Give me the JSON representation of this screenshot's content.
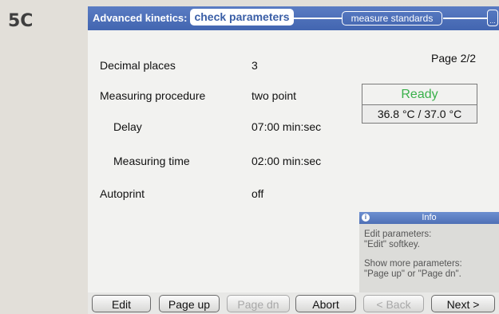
{
  "figure_label": "5C",
  "header": {
    "title": "Advanced kinetics:",
    "active_tab": "check parameters",
    "next_tab": "measure standards",
    "more_tab": "..."
  },
  "page_indicator": "Page 2/2",
  "parameters": [
    {
      "label": "Decimal places",
      "value": "3"
    },
    {
      "label": "Measuring procedure",
      "value": "two point"
    },
    {
      "label": "Delay",
      "value": "07:00 min:sec"
    },
    {
      "label": "Measuring time",
      "value": "02:00 min:sec"
    },
    {
      "label": "Autoprint",
      "value": "off"
    }
  ],
  "status": {
    "state": "Ready",
    "temperature": "36.8 °C / 37.0 °C",
    "state_color": "#39b04a"
  },
  "info": {
    "icon": "info-icon",
    "title": "Info",
    "line1": "Edit parameters:",
    "line2": "\"Edit\" softkey.",
    "line3": "Show more parameters:",
    "line4": "\"Page up\" or \"Page dn\"."
  },
  "softkeys": {
    "edit": "Edit",
    "page_up": "Page up",
    "page_dn": "Page dn",
    "abort": "Abort",
    "back": "< Back",
    "next": "Next >"
  },
  "colors": {
    "header_blue": "#4a6db5",
    "accent_green": "#39b04a"
  }
}
